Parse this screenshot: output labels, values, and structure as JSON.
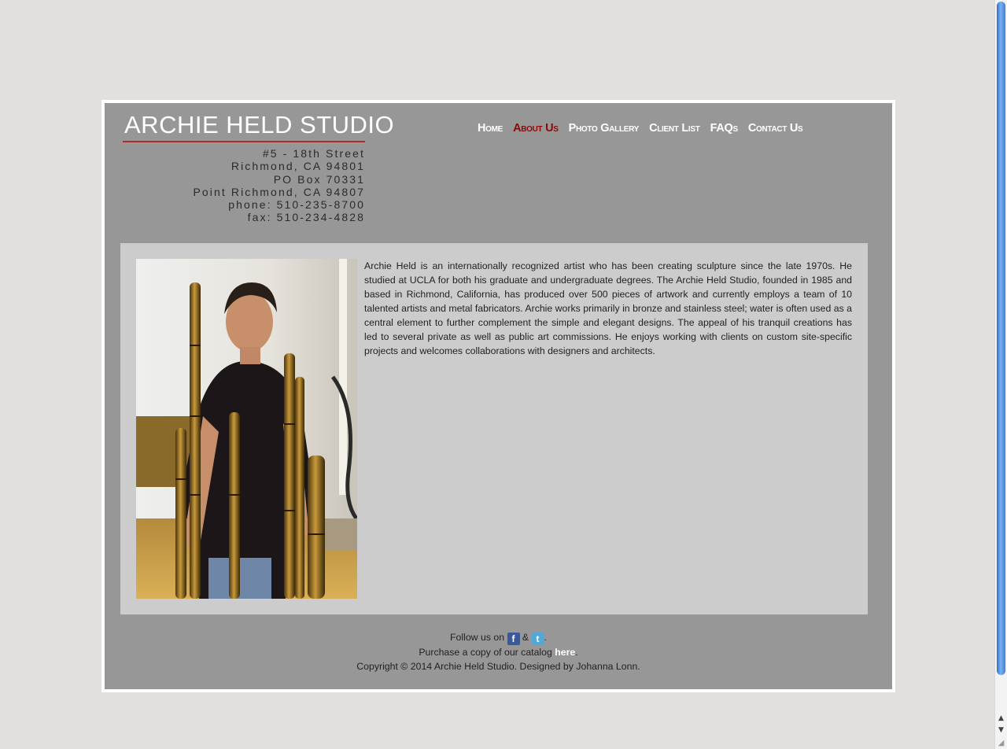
{
  "header": {
    "title": "ARCHIE HELD STUDIO",
    "address": [
      "#5 - 18th Street",
      "Richmond, CA 94801",
      "PO Box 70331",
      "Point Richmond, CA 94807",
      "phone: 510-235-8700",
      "fax: 510-234-4828"
    ]
  },
  "nav": {
    "items": [
      {
        "label": "Home"
      },
      {
        "label": "About Us"
      },
      {
        "label": "Photo Gallery"
      },
      {
        "label": "Client List"
      },
      {
        "label": "FAQs"
      },
      {
        "label": "Contact Us"
      }
    ],
    "active_color": "#8b0a0a"
  },
  "main": {
    "bio": "Archie Held is an internationally recognized artist who has been creating sculpture since the late 1970s. He studied at UCLA for both his graduate and undergraduate degrees. The Archie Held Studio, founded in 1985 and based in Richmond, California, has produced over 500 pieces of artwork and currently employs a team of 10 talented artists and metal fabricators. Archie works primarily in bronze and stainless steel; water is often used as a central element to further complement the simple and elegant designs. The appeal of his tranquil creations has led to several private as well as public art commissions. He enjoys working with clients on custom site-specific projects and welcomes collaborations with designers and architects."
  },
  "footer": {
    "follow_text": "Follow us on",
    "amp": "&",
    "period": ".",
    "facebook_icon": "facebook-icon",
    "twitter_icon": "twitter-icon",
    "catalog_text": "Purchase a copy of our catalog",
    "catalog_link": "here",
    "copyright": "Copyright © 2014 Archie Held Studio. Designed by Johanna Lonn."
  },
  "colors": {
    "page_bg": "#e2dfdd",
    "frame_bg": "#979797",
    "content_bg": "#cccccc",
    "accent_red": "#b02a2a"
  }
}
